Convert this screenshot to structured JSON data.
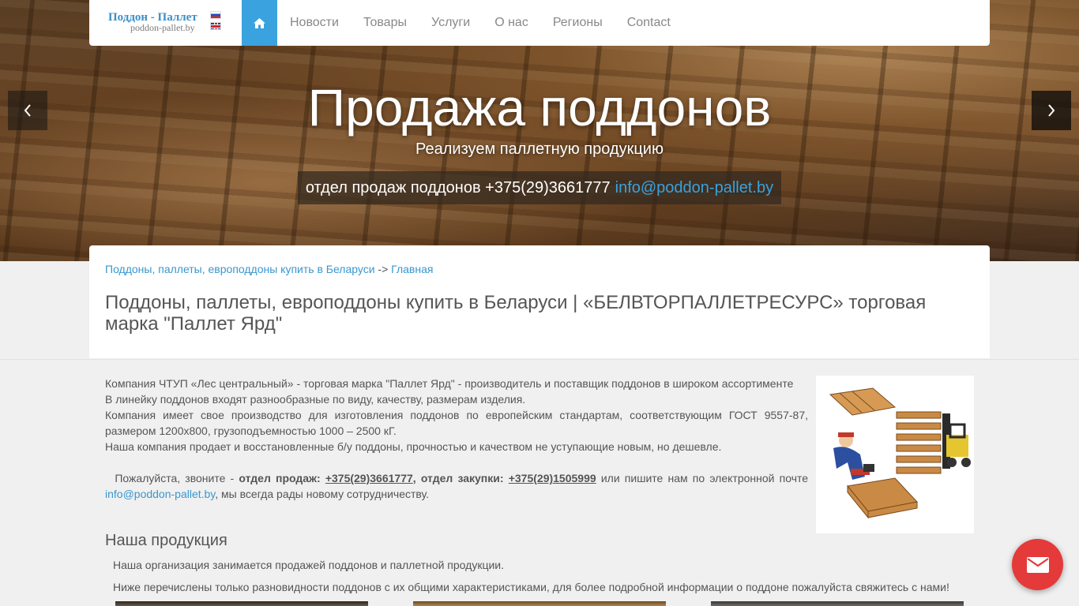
{
  "colors": {
    "accent": "#3aa2de",
    "link": "#3a97cf",
    "mail_button": "#e43a3a"
  },
  "logo": {
    "title": "Поддон - Паллет",
    "subtitle": "poddon-pallet.by"
  },
  "nav": {
    "home_icon": "home-icon",
    "items": [
      "Новости",
      "Товары",
      "Услуги",
      "О нас",
      "Регионы",
      "Contact"
    ]
  },
  "hero": {
    "title": "Продажа поддонов",
    "subtitle": "Реализуем паллетную продукцию",
    "contact_text": "отдел продаж поддонов +375(29)3661777",
    "email": "info@poddon-pallet.by"
  },
  "breadcrumb": {
    "home": "Поддоны, паллеты, европоддоны купить в Беларуси",
    "separator": " -> ",
    "current": "Главная"
  },
  "page_title": "Поддоны, паллеты, европоддоны купить в Беларуси | «БЕЛВТОРПАЛЛЕТРЕСУРС» торговая марка \"Паллет Ярд\"",
  "intro": {
    "line1": "Компания ЧТУП «Лес центральный» - торговая марка \"Паллет Ярд\" - производитель и поставщик поддонов в широком ассортименте",
    "line2": "В линейку поддонов входят разнообразные по виду, качеству, размерам изделия.",
    "line3": "Компания имеет свое производство для изготовления поддонов по европейским стандартам, соответствующим ГОСТ 9557-87, размером 1200х800, грузоподъемностью 1000 – 2500 кГ.",
    "line4": "Наша компания продает и восстановленные б/у поддоны, прочностью и качеством не уступающие новым, но дешевле.",
    "call_prefix": "Пожалуйста, звоните - ",
    "sales_label": "отдел продаж:",
    "sales_phone": "+375(29)3661777",
    "purchase_label": ", отдел закупки:",
    "purchase_phone": "+375(29)1505999",
    "write_text": " или пишите нам по электронной почте ",
    "email": "info@poddon-pallet.by",
    "closing": ", мы всегда рады новому сотрудничеству."
  },
  "products": {
    "heading": "Наша продукция",
    "para1": "Наша организация занимается продажей поддонов и паллетной продукции.",
    "para2": "Ниже перечислены только разновидности поддонов с их общими характеристиками, для более подробной информации о поддоне пожалуйста свяжитесь с нами!"
  },
  "mail_button_icon": "mail-icon"
}
